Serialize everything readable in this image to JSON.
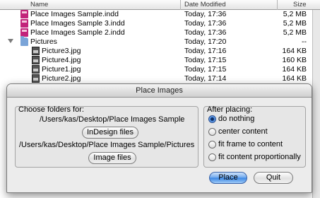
{
  "finder": {
    "columns": {
      "name": "Name",
      "date": "Date Modified",
      "size": "Size"
    },
    "rows": [
      {
        "name": "Place Images Sample.indd",
        "date": "Today, 17:36",
        "size": "5,2 MB",
        "icon": "indesign-file-icon"
      },
      {
        "name": "Place Images Sample 3.indd",
        "date": "Today, 17:36",
        "size": "5,2 MB",
        "icon": "indesign-file-icon"
      },
      {
        "name": "Place Images Sample 2.indd",
        "date": "Today, 17:36",
        "size": "5,2 MB",
        "icon": "indesign-file-icon"
      },
      {
        "name": "Pictures",
        "date": "Today, 17:20",
        "size": "--",
        "icon": "folder-icon"
      },
      {
        "name": "Picture3.jpg",
        "date": "Today, 17:16",
        "size": "164 KB",
        "icon": "jpg-file-icon"
      },
      {
        "name": "Picture4.jpg",
        "date": "Today, 17:15",
        "size": "160 KB",
        "icon": "jpg-file-icon"
      },
      {
        "name": "Picture1.jpg",
        "date": "Today, 17:15",
        "size": "164 KB",
        "icon": "jpg-file-icon"
      },
      {
        "name": "Picture2.jpg",
        "date": "Today, 17:14",
        "size": "164 KB",
        "icon": "jpg-file-icon"
      }
    ]
  },
  "dialog": {
    "title": "Place Images",
    "choose": {
      "label": "Choose folders for:",
      "indesign_path": "/Users/kas/Desktop/Place Images Sample",
      "indesign_button": "InDesign files",
      "image_path": "/Users/kas/Desktop/Place Images Sample/Pictures",
      "image_button": "Image files"
    },
    "after": {
      "label": "After placing:",
      "options": [
        "do nothing",
        "center content",
        "fit frame to content",
        "fit content proportionally"
      ],
      "selected": "do nothing"
    },
    "place_button": "Place",
    "quit_button": "Quit"
  },
  "colors": {
    "accent": "#3a86e4",
    "indesign": "#c2237a",
    "folder": "#7aa4d8"
  }
}
